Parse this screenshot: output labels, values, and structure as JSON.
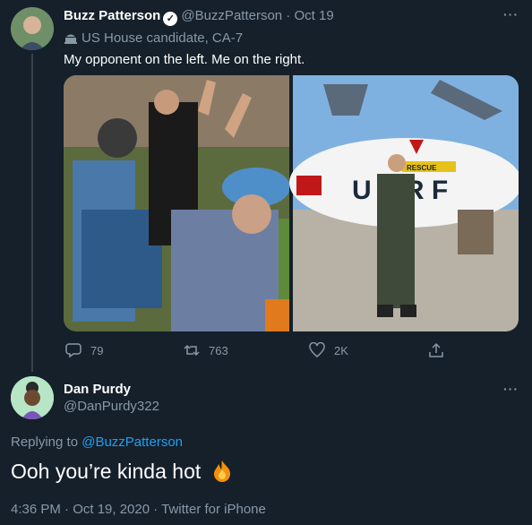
{
  "tweet": {
    "author_name": "Buzz Patterson",
    "handle": "@BuzzPatterson",
    "date": "Oct 19",
    "label": "US House candidate, CA-7",
    "text": "My opponent on the left. Me on the right.",
    "actions": {
      "replies": "79",
      "retweets": "763",
      "likes": "2K"
    },
    "image_signs": {
      "rescue": "RESCUE",
      "air": "U AIR F"
    }
  },
  "reply": {
    "author_name": "Dan Purdy",
    "handle": "@DanPurdy322",
    "replying_prefix": "Replying to",
    "replying_to": "@BuzzPatterson",
    "text": "Ooh you’re kinda hot",
    "timestamp": "4:36 PM · Oct 19, 2020 · Twitter for iPhone"
  },
  "colors": {
    "background": "#15202b",
    "accent": "#1da1f2",
    "muted": "#8899a6"
  }
}
